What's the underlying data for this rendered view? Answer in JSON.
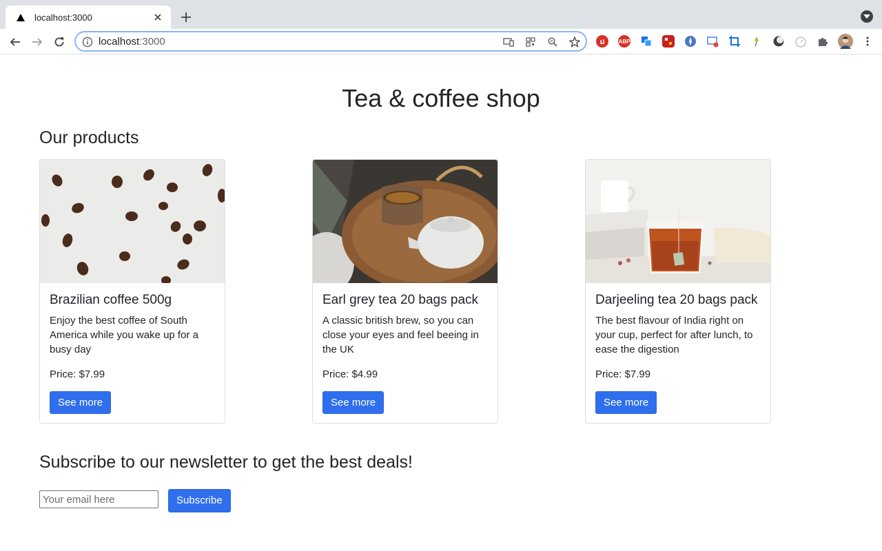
{
  "browser": {
    "tab_title": "localhost:3000",
    "url_host": "localhost",
    "url_port": ":3000"
  },
  "page": {
    "title": "Tea & coffee shop",
    "products_heading": "Our products",
    "products": [
      {
        "name": "Brazilian coffee 500g",
        "description": "Enjoy the best coffee of South America while you wake up for a busy day",
        "price": "Price: $7.99",
        "button": "See more"
      },
      {
        "name": "Earl grey tea 20 bags pack",
        "description": "A classic british brew, so you can close your eyes and feel beeing in the UK",
        "price": "Price: $4.99",
        "button": "See more"
      },
      {
        "name": "Darjeeling tea 20 bags pack",
        "description": "The best flavour of India right on your cup, perfect for after lunch, to ease the digestion",
        "price": "Price: $7.99",
        "button": "See more"
      }
    ],
    "newsletter": {
      "heading": "Subscribe to our newsletter to get the best deals!",
      "placeholder": "Your email here",
      "button": "Subscribe"
    }
  },
  "colors": {
    "primary": "#2f6fed",
    "text": "#212529"
  }
}
